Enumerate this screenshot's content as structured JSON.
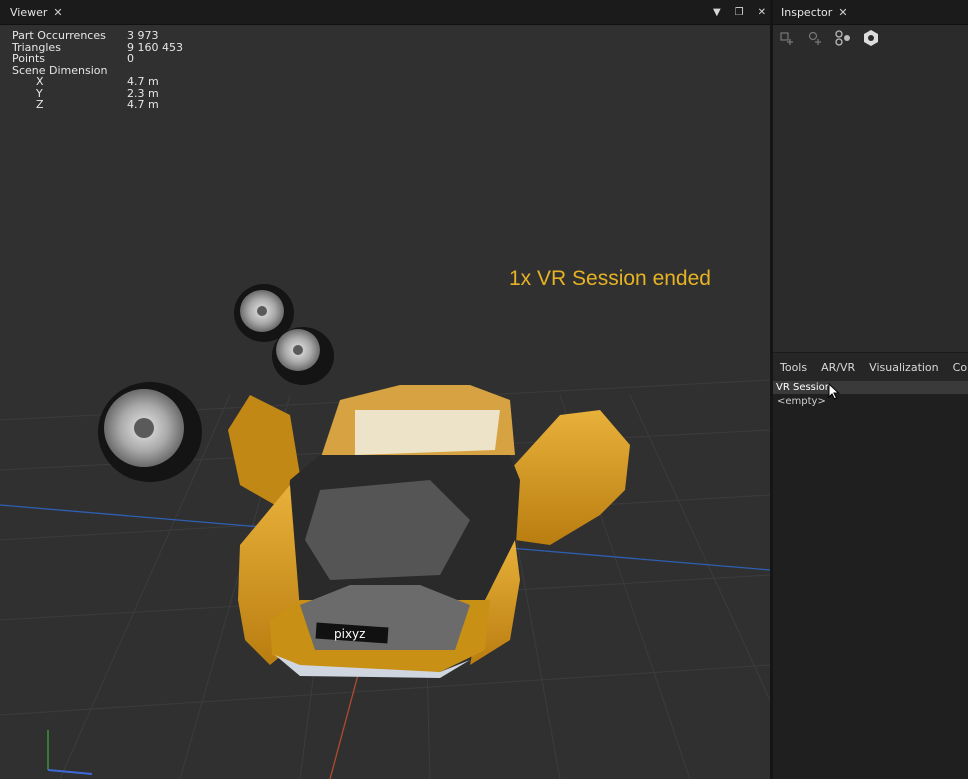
{
  "viewer": {
    "tab_label": "Viewer",
    "close": "✕",
    "controls": {
      "dropdown": "▼",
      "restore": "❐",
      "close": "✕"
    },
    "stats": [
      {
        "label": "Part Occurrences",
        "value": "3 973"
      },
      {
        "label": "Triangles",
        "value": "9 160 453"
      },
      {
        "label": "Points",
        "value": "0"
      },
      {
        "label": "Scene Dimension",
        "value": ""
      }
    ],
    "dimensions": [
      {
        "label": "X",
        "value": "4.7 m"
      },
      {
        "label": "Y",
        "value": "2.3 m"
      },
      {
        "label": "Z",
        "value": "4.7 m"
      }
    ],
    "toast": "1x VR Session ended",
    "plate_text": "pixyz",
    "colors": {
      "car_body": "#d69a1c",
      "toast": "#e6b324",
      "background": "#303030"
    }
  },
  "inspector": {
    "tab_label": "Inspector",
    "close": "✕",
    "toolbar_icons": [
      "add-component-icon",
      "add-component-alt-icon",
      "node-graph-icon",
      "hexagon-icon"
    ]
  },
  "bottom_panel": {
    "tabs": [
      "Tools",
      "AR/VR",
      "Visualization",
      "Collal"
    ],
    "list_header": "VR Session",
    "list_empty": "<empty>"
  }
}
